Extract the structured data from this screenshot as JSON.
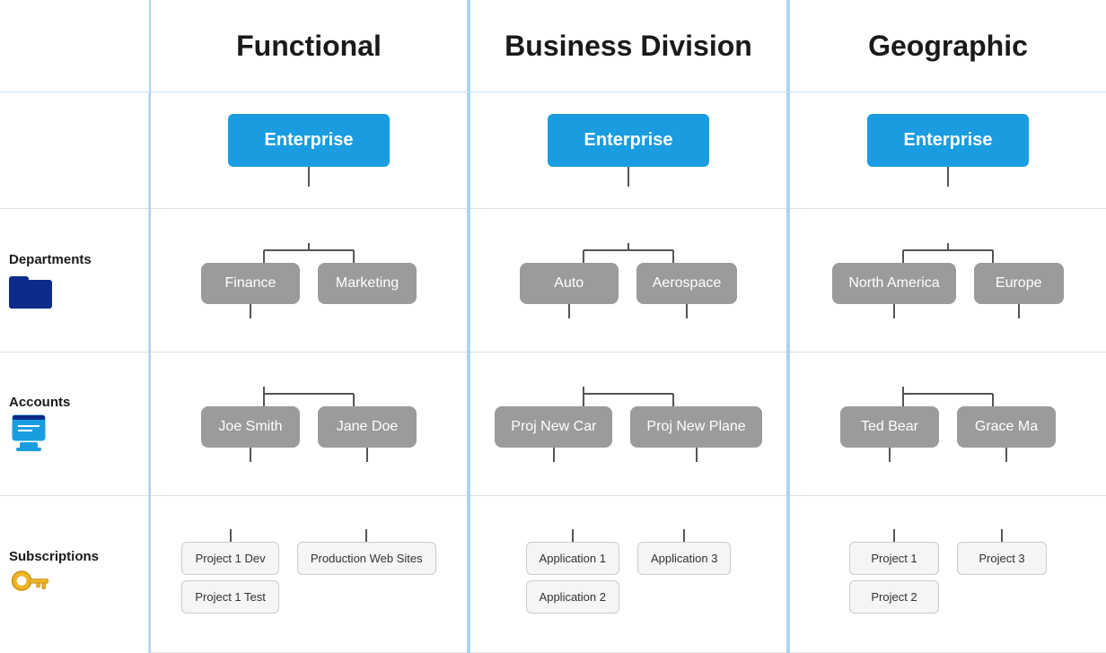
{
  "header": {
    "functional": "Functional",
    "business_division": "Business Division",
    "geographic": "Geographic"
  },
  "labels": {
    "departments": "Departments",
    "accounts": "Accounts",
    "subscriptions": "Subscriptions"
  },
  "functional": {
    "enterprise": "Enterprise",
    "dept1": "Finance",
    "dept2": "Marketing",
    "acct1": "Joe Smith",
    "acct2": "Jane Doe",
    "sub1": "Project 1 Dev",
    "sub2": "Project 1 Test",
    "sub3": "Production Web Sites"
  },
  "business": {
    "enterprise": "Enterprise",
    "dept1": "Auto",
    "dept2": "Aerospace",
    "acct1": "Proj New Car",
    "acct2": "Proj New Plane",
    "sub1": "Application 1",
    "sub2": "Application 2",
    "sub3": "Application 3"
  },
  "geographic": {
    "enterprise": "Enterprise",
    "dept1": "North America",
    "dept2": "Europe",
    "acct1": "Ted Bear",
    "acct2": "Grace Ma",
    "sub1": "Project 1",
    "sub2": "Project 2",
    "sub3": "Project 3"
  }
}
